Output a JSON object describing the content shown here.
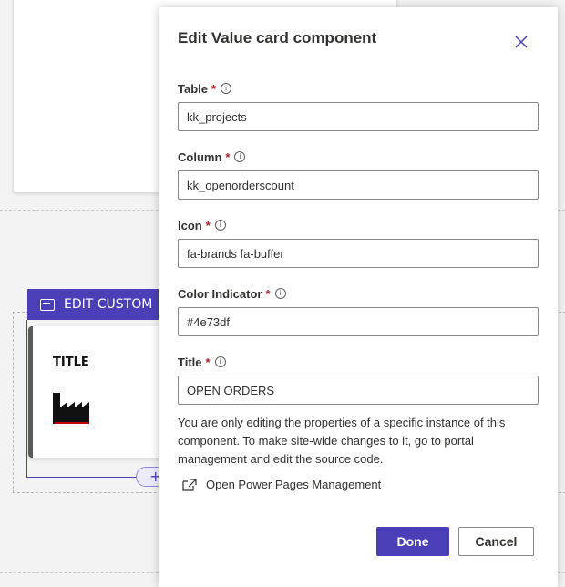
{
  "background": {
    "edit_tab_label": "EDIT CUSTOM",
    "card": {
      "title": "TITLE",
      "icon": "factory-icon"
    },
    "add_label": "+"
  },
  "dialog": {
    "title": "Edit Value card component",
    "fields": [
      {
        "label": "Table",
        "required_mark": "*",
        "value": "kk_projects"
      },
      {
        "label": "Column",
        "required_mark": "*",
        "value": "kk_openorderscount"
      },
      {
        "label": "Icon",
        "required_mark": "*",
        "value": "fa-brands fa-buffer"
      },
      {
        "label": "Color Indicator",
        "required_mark": "*",
        "value": "#4e73df"
      },
      {
        "label": "Title",
        "required_mark": "*",
        "value": "OPEN ORDERS"
      }
    ],
    "help_text": "You are only editing the properties of a specific instance of this component. To make site-wide changes to it, go to portal management and edit the source code.",
    "link_label": "Open Power Pages Management",
    "done_label": "Done",
    "cancel_label": "Cancel"
  },
  "colors": {
    "accent": "#4b3fb8",
    "required": "#a4262c"
  }
}
